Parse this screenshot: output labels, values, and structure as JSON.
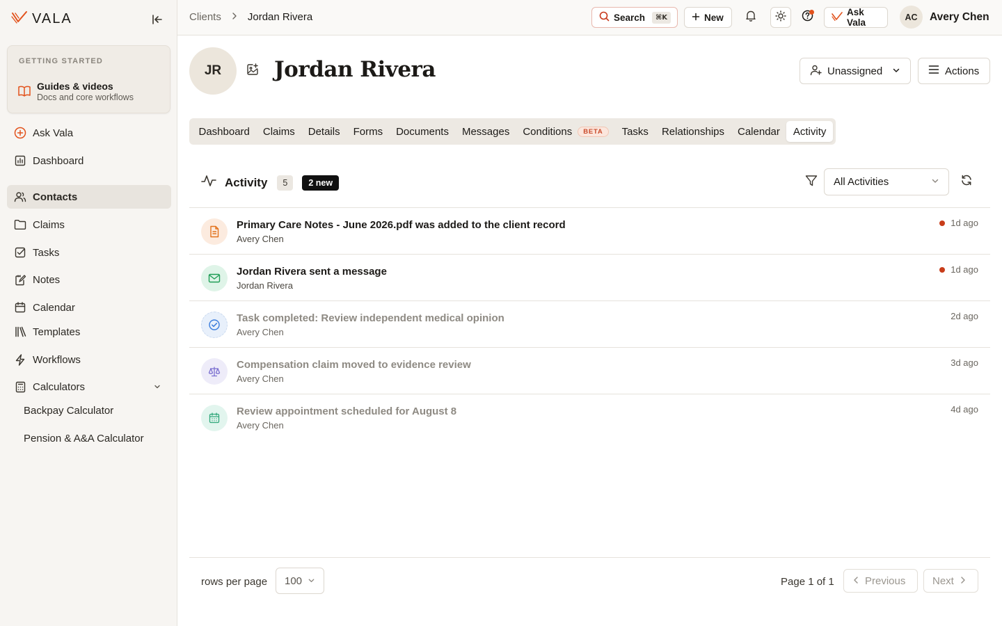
{
  "brand": {
    "name": "VALA",
    "accent": "#e2521c"
  },
  "sidebar": {
    "getting_started": {
      "heading": "GETTING STARTED",
      "title": "Guides & videos",
      "subtitle": "Docs and core workflows"
    },
    "items": [
      {
        "label": "Ask Vala",
        "icon": "plus-circle-icon"
      },
      {
        "label": "Dashboard",
        "icon": "chart-icon"
      },
      {
        "label": "Contacts",
        "icon": "users-icon",
        "active": true
      },
      {
        "label": "Claims",
        "icon": "folder-icon"
      },
      {
        "label": "Tasks",
        "icon": "checkbox-icon"
      },
      {
        "label": "Notes",
        "icon": "notes-icon"
      },
      {
        "label": "Calendar",
        "icon": "calendar-icon"
      },
      {
        "label": "Templates",
        "icon": "library-icon"
      },
      {
        "label": "Workflows",
        "icon": "bolt-icon"
      },
      {
        "label": "Calculators",
        "icon": "calculator-icon",
        "expanded": true
      }
    ],
    "sub_items": [
      "Backpay Calculator",
      "Pension & A&A Calculator"
    ]
  },
  "topbar": {
    "breadcrumb": [
      "Clients",
      "Jordan Rivera"
    ],
    "search_label": "Search",
    "search_shortcut": "⌘K",
    "new_label": "New",
    "ask_label": "Ask Vala",
    "user_initials": "AC",
    "user_name": "Avery Chen"
  },
  "client": {
    "initials": "JR",
    "name": "Jordan Rivera",
    "assignee": "Unassigned",
    "actions_label": "Actions"
  },
  "tabs": [
    {
      "label": "Dashboard"
    },
    {
      "label": "Claims"
    },
    {
      "label": "Details"
    },
    {
      "label": "Forms"
    },
    {
      "label": "Documents"
    },
    {
      "label": "Messages"
    },
    {
      "label": "Conditions",
      "badge": "BETA"
    },
    {
      "label": "Tasks"
    },
    {
      "label": "Relationships"
    },
    {
      "label": "Calendar"
    },
    {
      "label": "Activity",
      "active": true
    }
  ],
  "activity": {
    "title": "Activity",
    "count": "5",
    "new_badge": "2 new",
    "filter_value": "All Activities",
    "items": [
      {
        "title": "Primary Care Notes - June 2026.pdf was added to the client record",
        "actor": "Avery Chen",
        "time": "1d ago",
        "unread": true,
        "icon": "document-icon",
        "color": "#e2721c"
      },
      {
        "title": "Jordan Rivera sent a message",
        "actor": "Jordan Rivera",
        "time": "1d ago",
        "unread": true,
        "icon": "mail-icon",
        "color": "#1f9d55"
      },
      {
        "title": "Task completed: Review independent medical opinion",
        "actor": "Avery Chen",
        "time": "2d ago",
        "unread": false,
        "icon": "check-circle-icon",
        "color": "#3b7ddd"
      },
      {
        "title": "Compensation claim moved to evidence review",
        "actor": "Avery Chen",
        "time": "3d ago",
        "unread": false,
        "icon": "scale-icon",
        "color": "#7a6fd0"
      },
      {
        "title": "Review appointment scheduled for August 8",
        "actor": "Avery Chen",
        "time": "4d ago",
        "unread": false,
        "icon": "calendar-icon",
        "color": "#2fa77a"
      }
    ]
  },
  "pagination": {
    "rows_label": "rows per page",
    "rows_value": "100",
    "page_info": "Page 1 of 1",
    "prev_label": "Previous",
    "next_label": "Next"
  }
}
